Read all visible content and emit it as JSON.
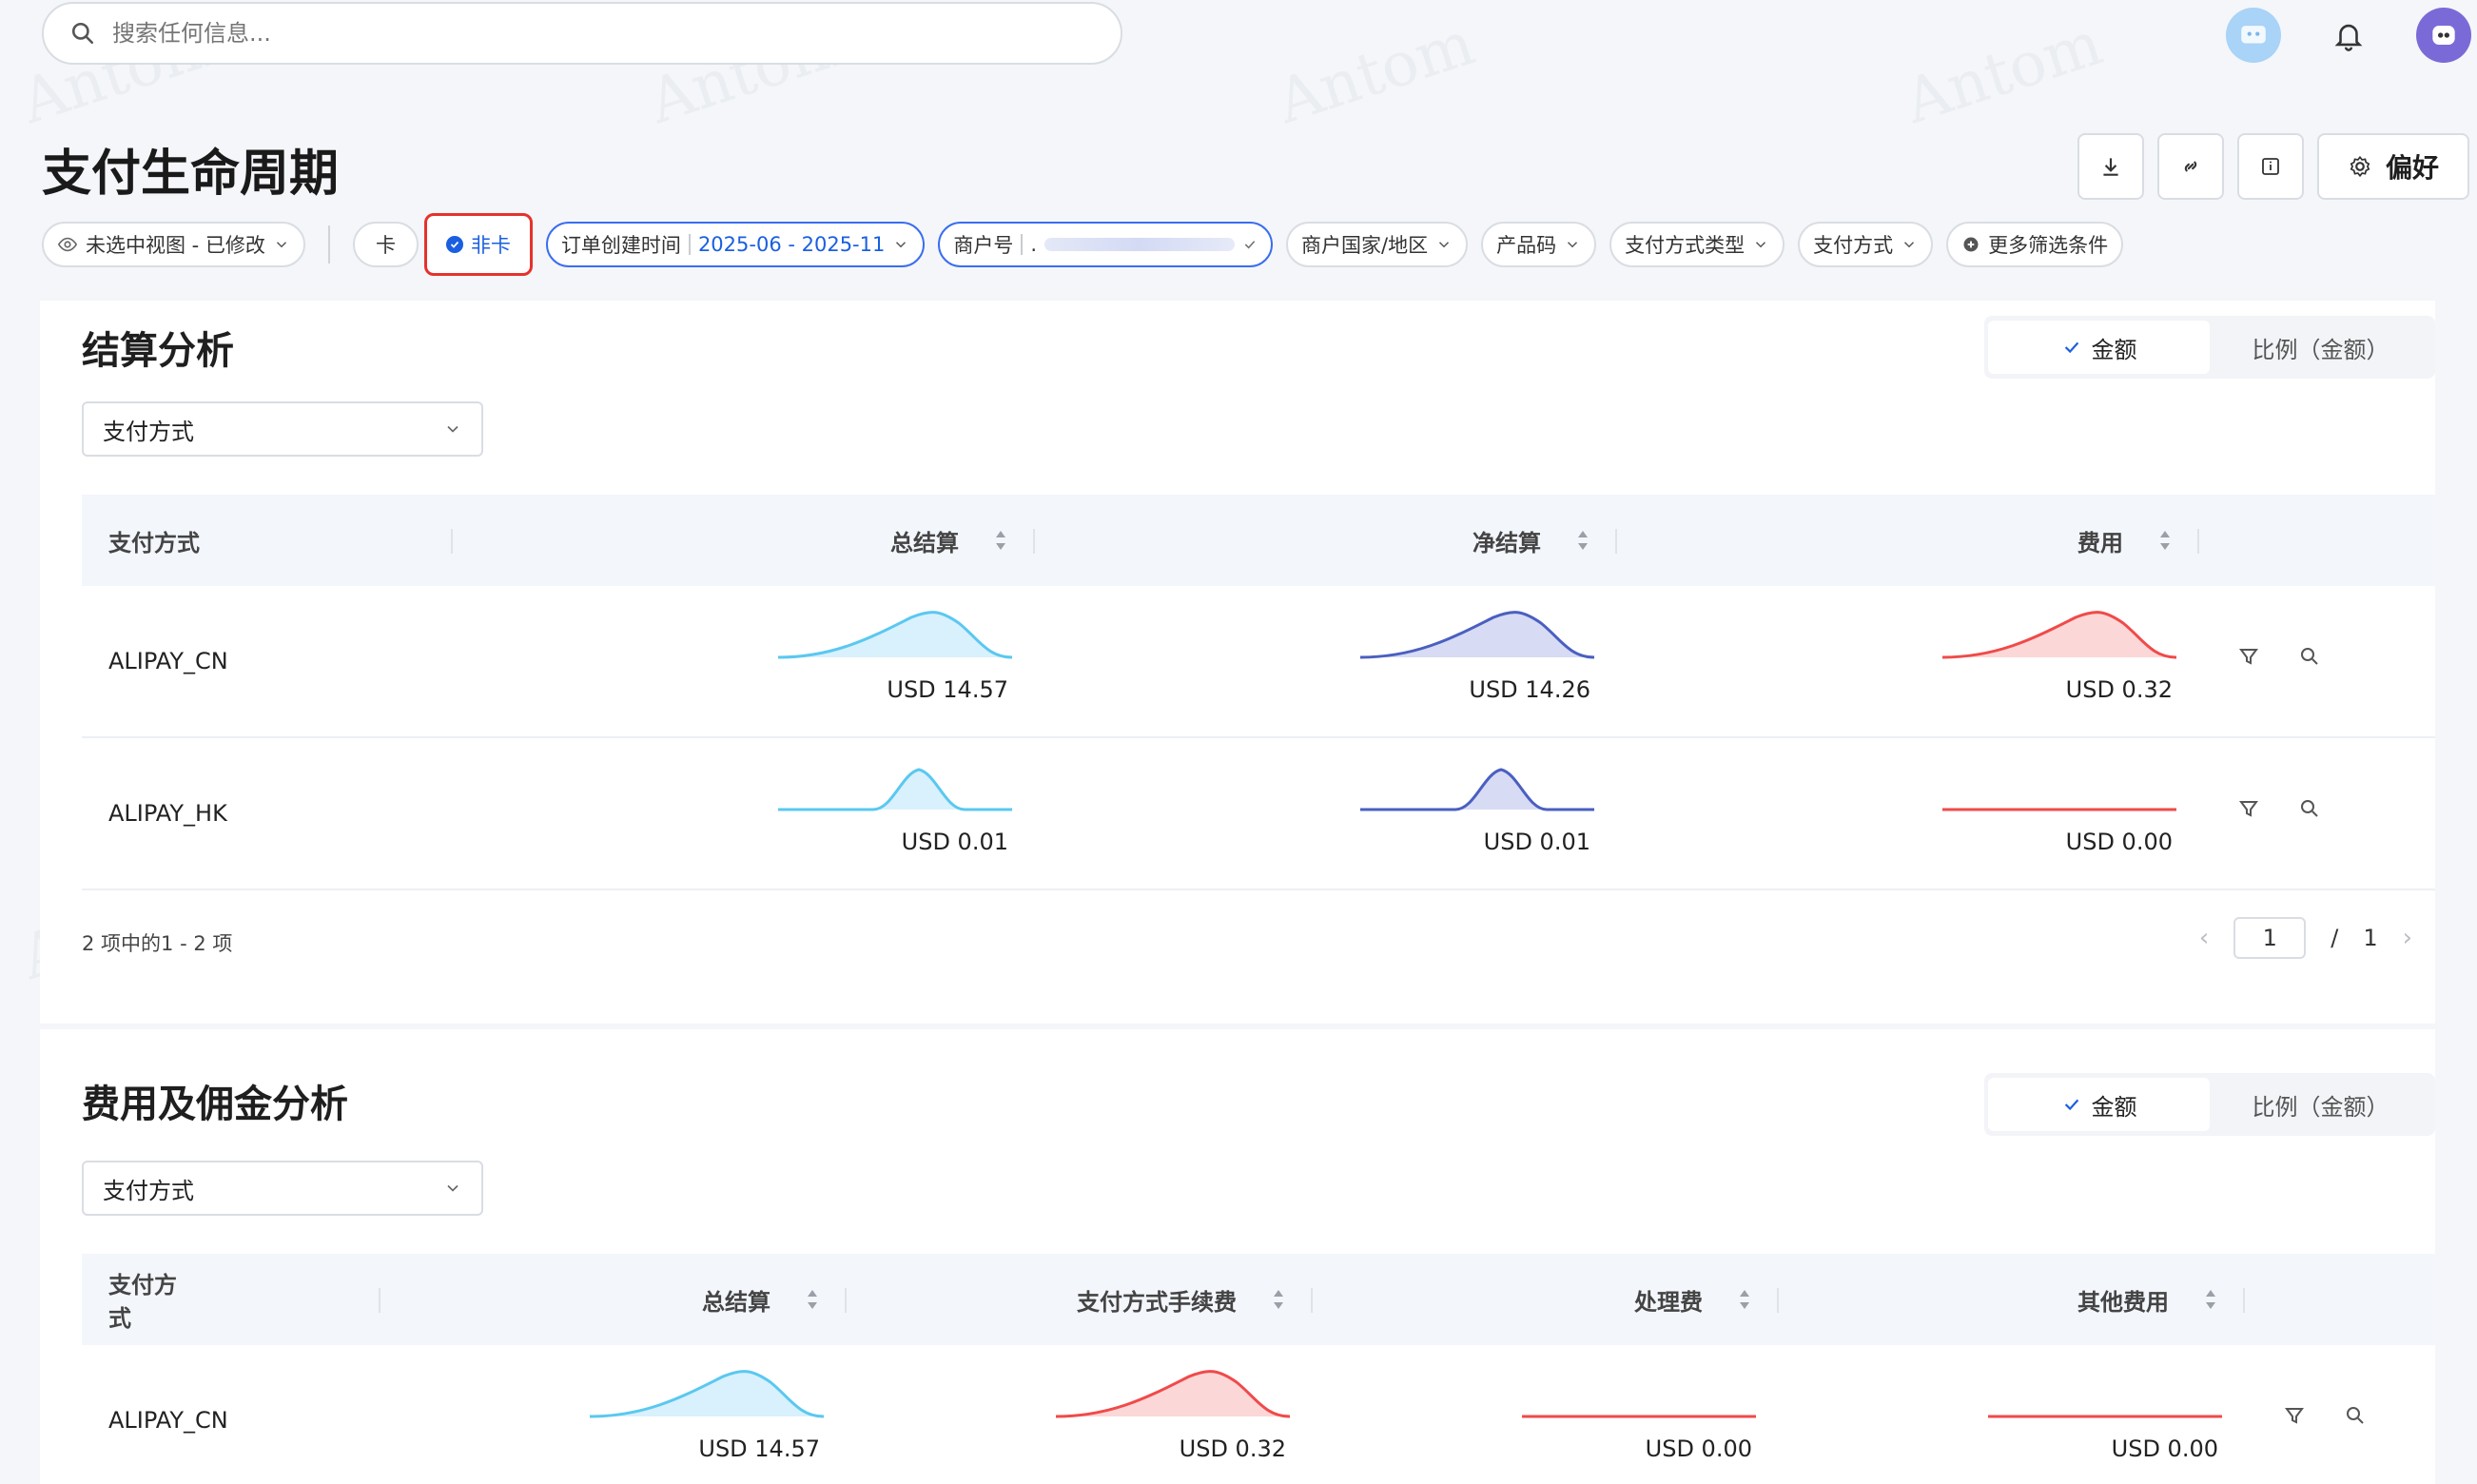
{
  "search": {
    "placeholder": "搜索任何信息..."
  },
  "header_icons": [
    "assistant-icon",
    "bell-icon",
    "avatar"
  ],
  "page": {
    "title": "支付生命周期"
  },
  "actions": {
    "prefs_label": "偏好"
  },
  "filters": {
    "view": "未选中视图 - 已修改",
    "card_option": "卡",
    "noncard_option": "非卡",
    "order_time_label": "订单创建时间",
    "order_time_value": "2025-06 - 2025-11",
    "merchant_label": "商户号",
    "merchant_value": ".",
    "country": "商户国家/地区",
    "product": "产品码",
    "pm_type": "支付方式类型",
    "pm": "支付方式",
    "more": "更多筛选条件"
  },
  "settlement": {
    "title": "结算分析",
    "toggle": {
      "amount": "金额",
      "ratio": "比例（金额）"
    },
    "group_by": "支付方式",
    "columns": [
      "支付方式",
      "总结算",
      "净结算",
      "费用"
    ],
    "rows": [
      {
        "name": "ALIPAY_CN",
        "total": "USD 14.57",
        "net": "USD 14.26",
        "fee": "USD 0.32"
      },
      {
        "name": "ALIPAY_HK",
        "total": "USD 0.01",
        "net": "USD 0.01",
        "fee": "USD 0.00"
      }
    ],
    "pager": {
      "info": "2 项中的1 - 2 项",
      "current": "1",
      "total": "1"
    }
  },
  "fees": {
    "title": "费用及佣金分析",
    "toggle": {
      "amount": "金额",
      "ratio": "比例（金额）"
    },
    "group_by": "支付方式",
    "columns": [
      "支付方式",
      "总结算",
      "支付方式手续费",
      "处理费",
      "其他费用"
    ],
    "rows": [
      {
        "name": "ALIPAY_CN",
        "total": "USD 14.57",
        "pm_fee": "USD 0.32",
        "processing": "USD 0.00",
        "other": "USD 0.00"
      }
    ]
  },
  "colors": {
    "primary": "#1a5fe0",
    "highlight": "#e5322d",
    "spark_blue": "#5ac8f0",
    "spark_navy": "#4a5fc0",
    "spark_red": "#f04a4a"
  }
}
